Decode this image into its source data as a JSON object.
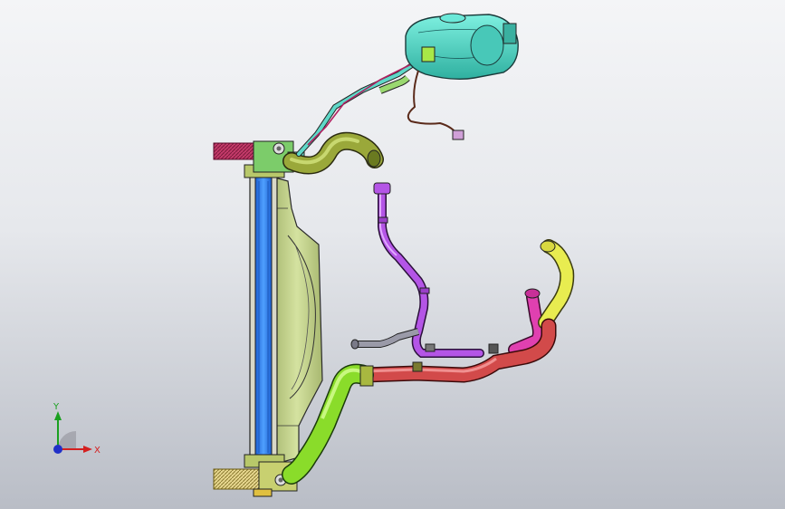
{
  "viewport": {
    "background_top": "#f4f5f7",
    "background_bottom": "#b9bdc6"
  },
  "triad": {
    "x_label": "X",
    "y_label": "Y",
    "x_color": "#d42020",
    "y_color": "#1aa020",
    "z_color": "#2030c8"
  },
  "parts": [
    {
      "name": "coolant-reservoir",
      "color": "#4fd6c4"
    },
    {
      "name": "radiator",
      "color": "#3a8ef0"
    },
    {
      "name": "fan-shroud",
      "color": "#c8d88c"
    },
    {
      "name": "upper-hose",
      "color": "#9aa83a"
    },
    {
      "name": "lower-hose-green",
      "color": "#8adc2a"
    },
    {
      "name": "lower-hose-red",
      "color": "#d24a4a"
    },
    {
      "name": "purple-pipe",
      "color": "#b455e6"
    },
    {
      "name": "magenta-hose",
      "color": "#e040b0"
    },
    {
      "name": "yellow-hose",
      "color": "#e8ec50"
    }
  ]
}
